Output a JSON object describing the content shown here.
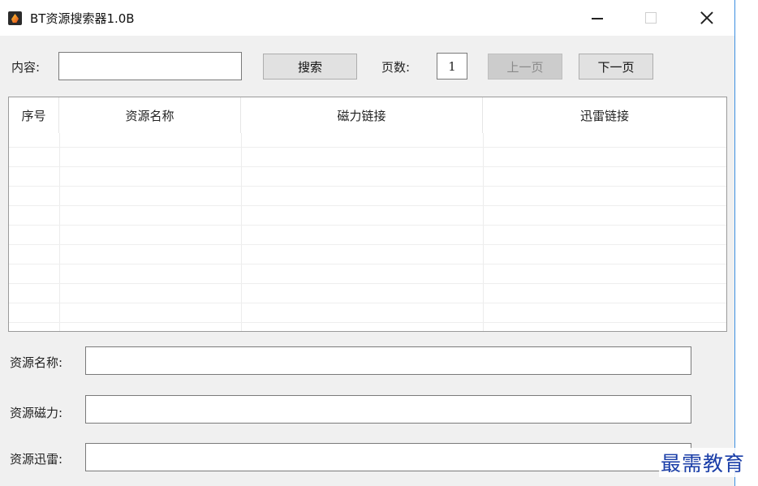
{
  "window": {
    "title": "BT资源搜索器1.0B"
  },
  "search": {
    "content_label": "内容:",
    "content_value": "",
    "search_button": "搜索",
    "page_label": "页数:",
    "page_value": "1",
    "prev_button": "上一页",
    "next_button": "下一页"
  },
  "table": {
    "columns": [
      "序号",
      "资源名称",
      "磁力链接",
      "迅雷链接"
    ],
    "rows": []
  },
  "details": {
    "name_label": "资源名称:",
    "name_value": "",
    "magnet_label": "资源磁力:",
    "magnet_value": "",
    "thunder_label": "资源迅雷:",
    "thunder_value": ""
  },
  "watermark": {
    "text": "最需教育"
  },
  "colors": {
    "window_bg": "#f0f0f0",
    "disabled_button": "#cccccc",
    "watermark": "#1a3ea8"
  }
}
